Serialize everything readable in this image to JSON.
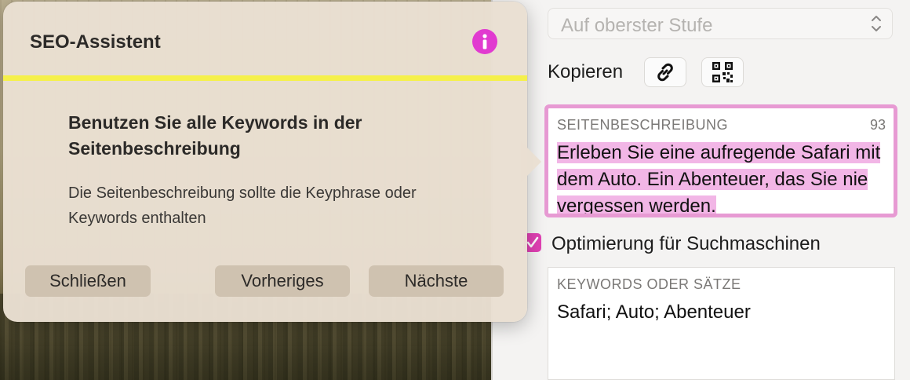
{
  "level_select": {
    "value": "Auf oberster Stufe",
    "icon": "up-down-chevron-icon"
  },
  "copy": {
    "label": "Kopieren",
    "link_icon": "link-icon",
    "qr_icon": "qr-code-icon"
  },
  "description": {
    "label": "SEITENBESCHREIBUNG",
    "count": "93",
    "text": "Erleben Sie eine aufregende Safari mit dem Auto. Ein Abenteuer, das Sie nie vergessen werden.",
    "highlight": "#f2b6e6",
    "border": "#e79ad3"
  },
  "seo": {
    "label": "Optimierung für Suchmaschinen",
    "checked": true,
    "color": "#e040b3"
  },
  "keywords": {
    "label": "KEYWORDS ODER SÄTZE",
    "value": "Safari; Auto; Abenteuer"
  },
  "popover": {
    "title": "SEO-Assistent",
    "info_icon": "info-icon",
    "heading": "Benutzen Sie alle Keywords in der Seitenbeschreibung",
    "body": "Die Seitenbeschreibung sollte die Keyphrase oder Keywords enthalten",
    "buttons": {
      "close": "Schließen",
      "previous": "Vorheriges",
      "next": "Nächste"
    },
    "accent": "#f5f04a"
  }
}
